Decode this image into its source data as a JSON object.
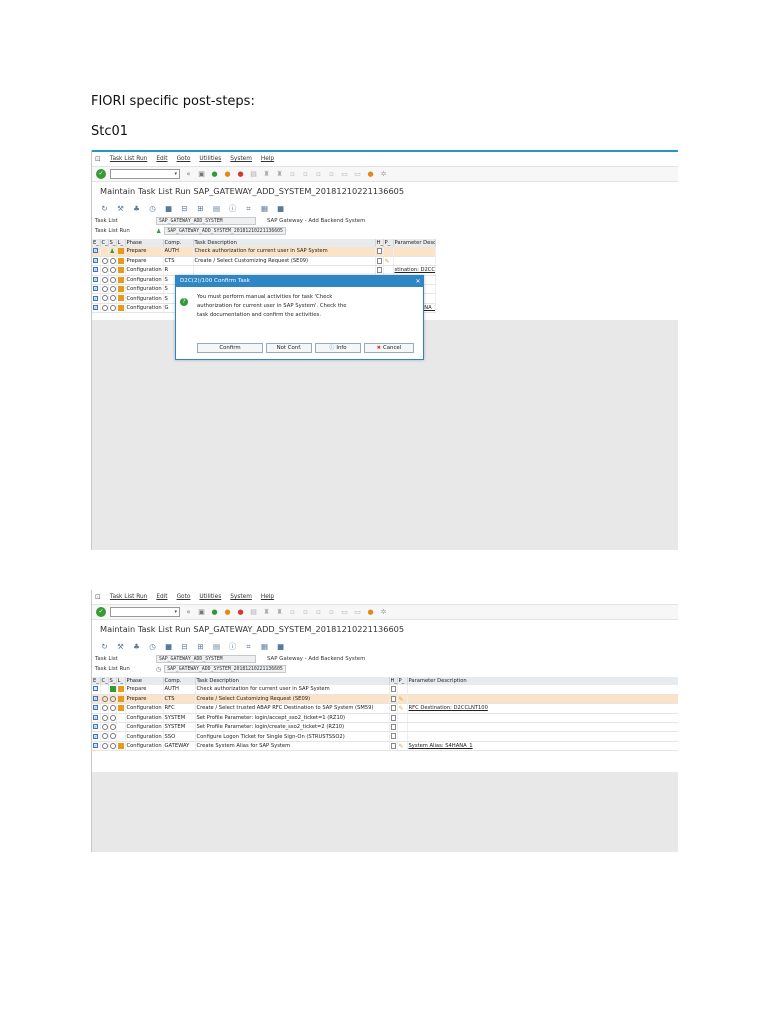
{
  "doc": {
    "heading": "FIORI specific post-steps:",
    "subheading": "Stc01"
  },
  "sap": {
    "menu": [
      "Task List Run",
      "Edit",
      "Goto",
      "Utilities",
      "System",
      "Help"
    ],
    "title": "Maintain Task List Run SAP_GATEWAY_ADD_SYSTEM_20181210221136605",
    "fields": {
      "task_list_label": "Task List",
      "task_list_value": "SAP_GATEWAY_ADD_SYSTEM",
      "task_list_desc": "SAP Gateway - Add Backend System",
      "run_label": "Task List Run",
      "run_value": "SAP_GATEWAY_ADD_SYSTEM_20181210221136605"
    },
    "columns": [
      "E_",
      "C_",
      "S_",
      "L_",
      "Phase",
      "Comp.",
      "Task Description",
      "H_",
      "P_",
      "Parameter Description"
    ],
    "rows": [
      {
        "phase": "Prepare",
        "comp": "AUTH",
        "task": "Check authorization for current user in SAP System",
        "param": ""
      },
      {
        "phase": "Prepare",
        "comp": "CTS",
        "task": "Create / Select Customizing Request (SE09)",
        "param": ""
      },
      {
        "phase": "Configuration",
        "comp": "RFC",
        "task": "Create / Select trusted ABAP RFC Destination to SAP System (SM59)",
        "param": "RFC Destination: D2CCLNT100"
      },
      {
        "phase": "Configuration",
        "comp": "SYSTEM",
        "task": "Set Profile Parameter: login/accept_sso2_ticket=1 (RZ10)",
        "param": ""
      },
      {
        "phase": "Configuration",
        "comp": "SYSTEM",
        "task": "Set Profile Parameter: login/create_sso2_ticket=2 (RZ10)",
        "param": ""
      },
      {
        "phase": "Configuration",
        "comp": "SSO",
        "task": "Configure Logon Ticket for Single Sign-On (STRUSTSSO2)",
        "param": ""
      },
      {
        "phase": "Configuration",
        "comp": "GATEWAY",
        "task": "Create System Alias for SAP System",
        "param": "System Alias: S4HANA_1"
      }
    ],
    "rows_visible_shot1": [
      {
        "phase": "Prepare",
        "comp": "AUTH",
        "task": "Check authorization for current user in SAP System",
        "param": ""
      },
      {
        "phase": "Prepare",
        "comp": "CTS",
        "task": "Create / Select Customizing Request (SE09)",
        "param": ""
      },
      {
        "phase": "Configuration",
        "comp": "R",
        "task": "",
        "param": "stination: D2CCLNT100"
      },
      {
        "phase": "Configuration",
        "comp": "S",
        "task": "",
        "param": ""
      },
      {
        "phase": "Configuration",
        "comp": "S",
        "task": "",
        "param": ""
      },
      {
        "phase": "Configuration",
        "comp": "S",
        "task": "",
        "param": ""
      },
      {
        "phase": "Configuration",
        "comp": "G",
        "task": "",
        "param": "Alias: S4HANA_1"
      }
    ],
    "dialog": {
      "title": "D2C(2)/100 Confirm Task",
      "message_1": "You must perform manual activities for task 'Check",
      "message_2": "authorization for current user in SAP System'. Check the",
      "message_3": "task documentation and confirm the activities.",
      "btn_confirm": "Confirm",
      "btn_notconf": "Not Conf.",
      "btn_info": "Info",
      "btn_cancel": "Cancel"
    }
  }
}
